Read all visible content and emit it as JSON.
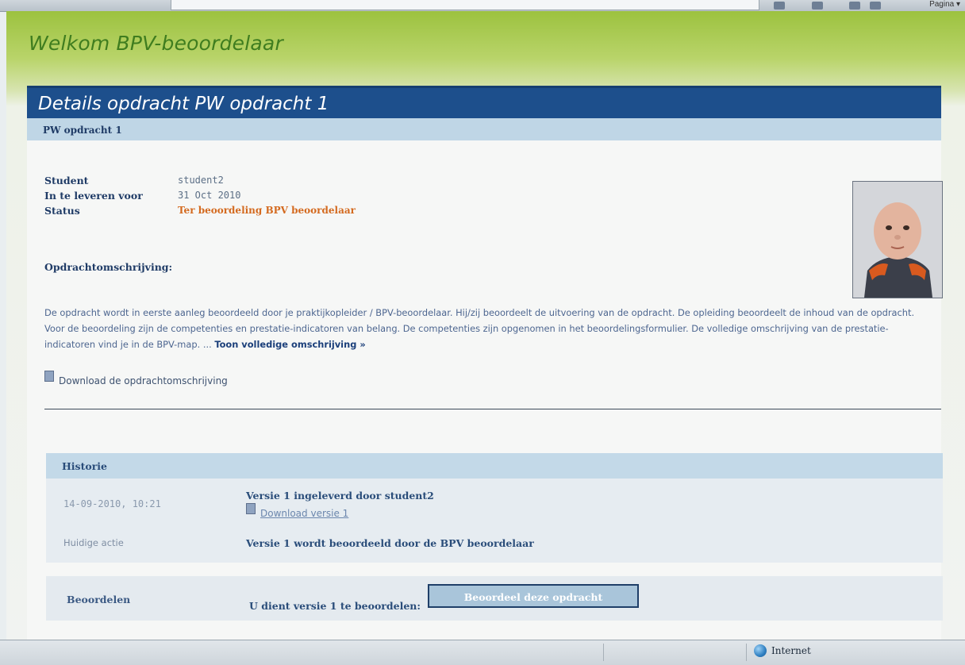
{
  "browser": {
    "toolbar_right_label": "Pagina ▾",
    "zone_label": "Internet"
  },
  "page": {
    "welcome": "Welkom BPV-beoordelaar",
    "panel_title": "Details opdracht PW opdracht 1",
    "subheader": "PW opdracht 1",
    "details": [
      {
        "label": "Student",
        "value": "student2"
      },
      {
        "label": "In te leveren voor",
        "value": "31 Oct 2010"
      },
      {
        "label": "Status",
        "value": "Ter beoordeling BPV beoordelaar"
      }
    ],
    "description_title": "Opdrachtomschrijving:",
    "description_text": "De opdracht wordt in eerste aanleg beoordeeld door je praktijkopleider / BPV-beoordelaar. Hij/zij beoordeelt de uitvoering van de opdracht. De opleiding beoordeelt de inhoud van de opdracht. Voor de beoordeling zijn de competenties en prestatie-indicatoren van belang. De competenties zijn opgenomen in het beoordelingsformulier. De volledige omschrijving van de prestatie-indicatoren vind je in de BPV-map. ...",
    "description_more": "Toon volledige omschrijving »",
    "download_description": "Download de opdrachtomschrijving"
  },
  "history": {
    "title": "Historie",
    "entry_date": "14-09-2010, 10:21",
    "entry_version": "Versie 1 ingeleverd door student2",
    "entry_download": "Download versie 1",
    "current_label": "Huidige actie",
    "current_value": "Versie 1 wordt beoordeeld door de BPV beoordelaar"
  },
  "assess": {
    "label": "Beoordelen",
    "text": "U dient versie 1 te beoordelen:",
    "button": "Beoordeel deze opdracht"
  },
  "colors": {
    "header_blue": "#1d4f8c",
    "status_orange": "#d46a1f",
    "welcome_green": "#3f7d1f"
  }
}
